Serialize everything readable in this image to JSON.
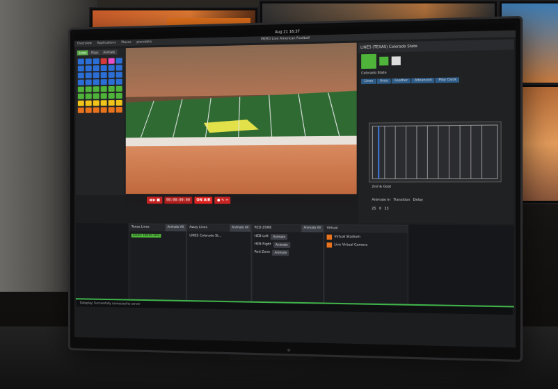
{
  "desktop": {
    "clock": "Aug 21  16:37",
    "window_title": "PIERO Live American Football",
    "menu": [
      "Overview",
      "Applications",
      "Places",
      "pierodata"
    ]
  },
  "left_panel": {
    "tabs": [
      "Lines",
      "Plays",
      "Animate"
    ],
    "tool_colors": [
      "#2b6fd6",
      "#2b6fd6",
      "#2b6fd6",
      "#d43a3a",
      "#e84ec8",
      "#2b6fd6",
      "#2b6fd6",
      "#2b6fd6",
      "#2b6fd6",
      "#2b6fd6",
      "#2b6fd6",
      "#2b6fd6",
      "#2b6fd6",
      "#2b6fd6",
      "#2b6fd6",
      "#2b6fd6",
      "#2b6fd6",
      "#2b6fd6",
      "#2b6fd6",
      "#2b6fd6",
      "#2b6fd6",
      "#2b6fd6",
      "#2b6fd6",
      "#2b6fd6",
      "#4fb53a",
      "#4fb53a",
      "#4fb53a",
      "#4fb53a",
      "#4fb53a",
      "#4fb53a",
      "#4fb53a",
      "#4fb53a",
      "#4fb53a",
      "#4fb53a",
      "#4fb53a",
      "#4fb53a",
      "#f0c419",
      "#f0c419",
      "#f0c419",
      "#f0c419",
      "#f0c419",
      "#f0c419",
      "#e8731c",
      "#e8731c",
      "#e8731c",
      "#e8731c",
      "#e8731c",
      "#e8731c"
    ]
  },
  "player": {
    "timecode": "00:00:00:00",
    "on_air": "ON AIR"
  },
  "right_panel": {
    "title": "LINES (TEXAS) Colorado State",
    "team_a": "Colorado State",
    "tabs": [
      "Lines",
      "Area",
      "Feather",
      "Advanced",
      "Play Clock"
    ],
    "field_label": "2nd & Goal",
    "footer": [
      "Animate In",
      "Transition",
      "Delay"
    ],
    "values": [
      "25",
      "0",
      "15"
    ]
  },
  "bottom": {
    "col1": {
      "title": "Texas Lines",
      "btn": "Animate All",
      "item": "Lines: Horns LOS"
    },
    "col2": {
      "title": "Away Lines",
      "btn": "Animate All",
      "item": "LINES Colorado St..."
    },
    "col3": {
      "title": "RED ZONE",
      "btn": "Animate All",
      "items": [
        "HEB-Left",
        "HEB-Right",
        "Red Zone"
      ],
      "item_btn": "Animate"
    },
    "col4": {
      "title": "Virtual",
      "items": [
        "Virtual Stadium",
        "Live Virtual Camera"
      ]
    },
    "status": "Dataplay: Successfully connected to server"
  },
  "bg_screen_text": "ORANGE"
}
